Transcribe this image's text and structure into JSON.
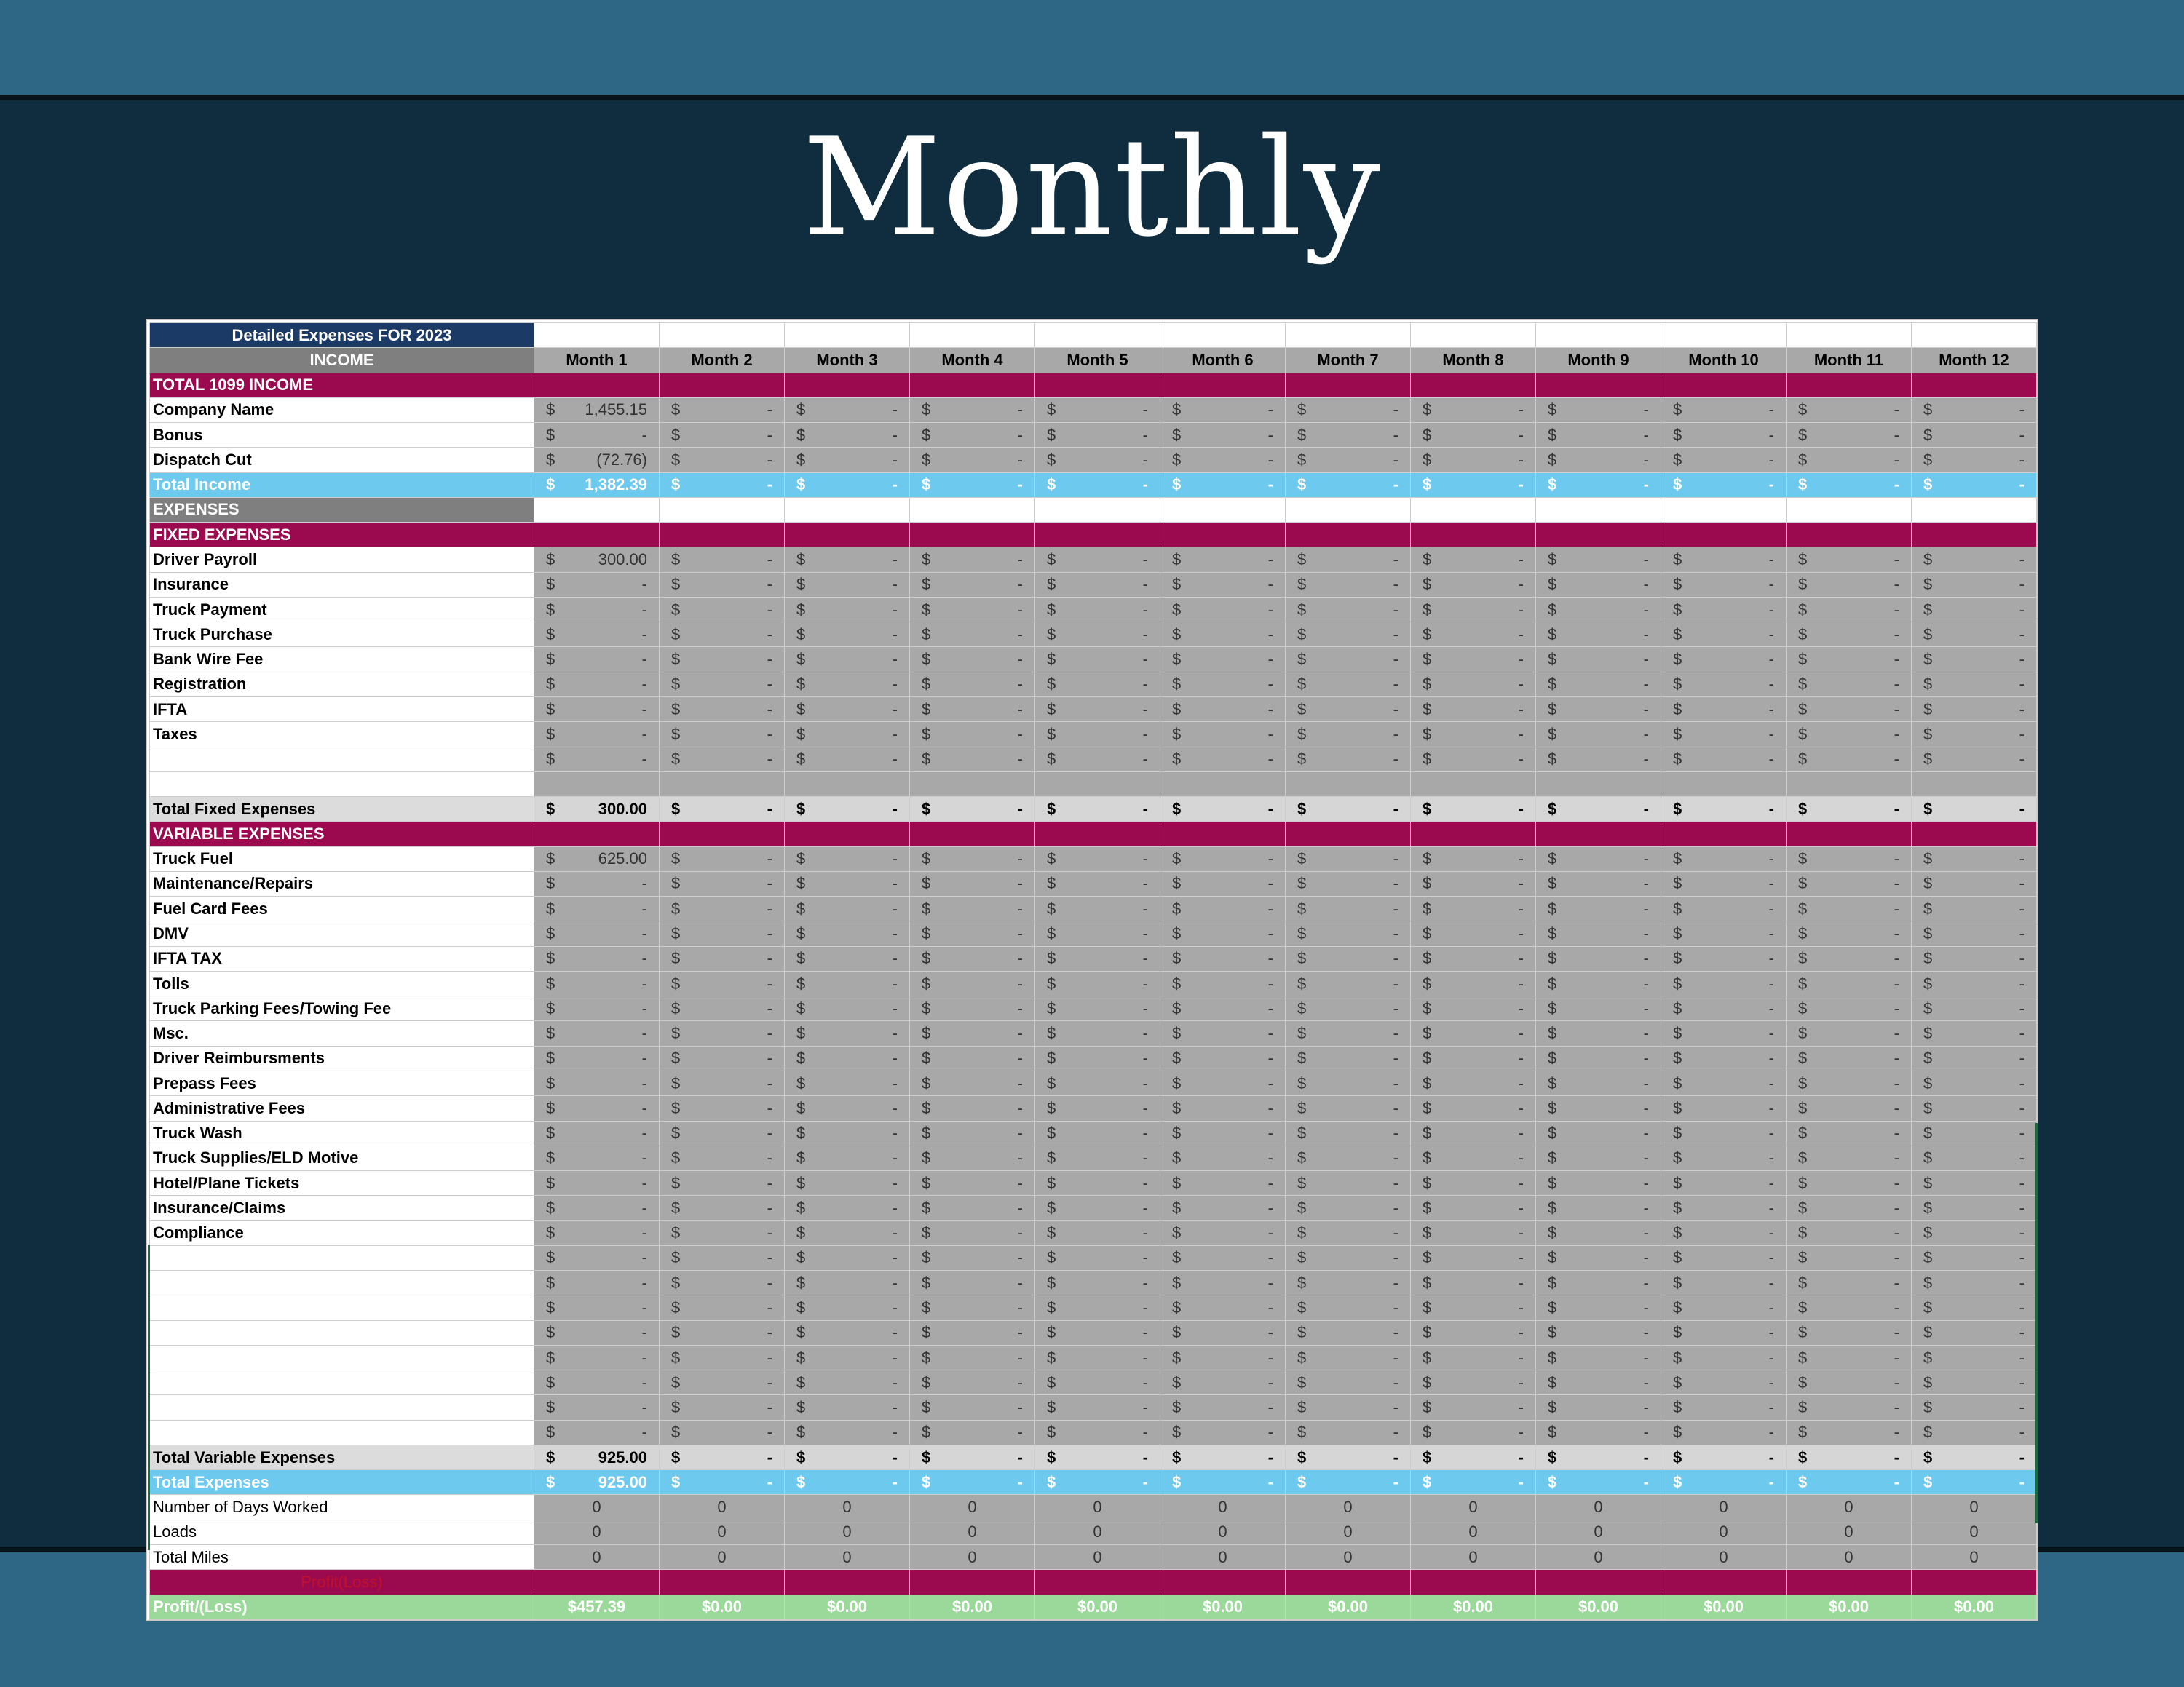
{
  "page_title": "Monthly",
  "sheet": {
    "title": "Detailed Expenses FOR 2023",
    "months": [
      "Month 1",
      "Month 2",
      "Month 3",
      "Month 4",
      "Month 5",
      "Month 6",
      "Month 7",
      "Month 8",
      "Month 9",
      "Month 10",
      "Month 11",
      "Month 12"
    ],
    "currency_symbol": "$",
    "dash": "-",
    "income_label": "INCOME",
    "total_1099_label": "TOTAL 1099 INCOME",
    "income_rows": [
      {
        "label": "Company Name",
        "first": "1,455.15"
      },
      {
        "label": "Bonus",
        "first": "-"
      },
      {
        "label": "Dispatch Cut",
        "first": "(72.76)"
      }
    ],
    "total_income": {
      "label": "Total Income",
      "first": "1,382.39"
    },
    "expenses_label": "EXPENSES",
    "fixed_label": "FIXED EXPENSES",
    "fixed_rows": [
      {
        "label": "Driver Payroll",
        "first": "300.00"
      },
      {
        "label": "Insurance",
        "first": "-"
      },
      {
        "label": "Truck Payment",
        "first": "-"
      },
      {
        "label": "Truck Purchase",
        "first": "-"
      },
      {
        "label": "Bank Wire Fee",
        "first": "-"
      },
      {
        "label": "Registration",
        "first": "-"
      },
      {
        "label": "IFTA",
        "first": "-"
      },
      {
        "label": "Taxes",
        "first": "-"
      },
      {
        "label": "",
        "first": "-"
      }
    ],
    "total_fixed": {
      "label": "Total Fixed Expenses",
      "first": "300.00"
    },
    "variable_label": "VARIABLE EXPENSES",
    "variable_rows": [
      {
        "label": "Truck Fuel",
        "first": "625.00"
      },
      {
        "label": "Maintenance/Repairs",
        "first": "-"
      },
      {
        "label": "Fuel Card Fees",
        "first": "-"
      },
      {
        "label": "DMV",
        "first": "-"
      },
      {
        "label": "IFTA TAX",
        "first": "-"
      },
      {
        "label": "Tolls",
        "first": "-"
      },
      {
        "label": "Truck Parking Fees/Towing Fee",
        "first": "-"
      },
      {
        "label": "Msc.",
        "first": "-"
      },
      {
        "label": "Driver Reimbursments",
        "first": "-"
      },
      {
        "label": "Prepass Fees",
        "first": "-"
      },
      {
        "label": "Administrative Fees",
        "first": "-"
      },
      {
        "label": "Truck Wash",
        "first": "-"
      },
      {
        "label": "Truck Supplies/ELD Motive",
        "first": "-"
      },
      {
        "label": "Hotel/Plane Tickets",
        "first": "-"
      },
      {
        "label": "Insurance/Claims",
        "first": "-"
      },
      {
        "label": "Compliance",
        "first": "-"
      },
      {
        "label": "",
        "first": "-"
      },
      {
        "label": "",
        "first": "-"
      },
      {
        "label": "",
        "first": "-"
      },
      {
        "label": "",
        "first": "-"
      },
      {
        "label": "",
        "first": "-"
      },
      {
        "label": "",
        "first": "-"
      },
      {
        "label": "",
        "first": "-"
      },
      {
        "label": "",
        "first": "-"
      }
    ],
    "total_variable": {
      "label": "Total Variable Expenses",
      "first": "925.00"
    },
    "total_expenses": {
      "label": "Total Expenses",
      "first": "925.00"
    },
    "stats_rows": [
      {
        "label": "Number of Days Worked",
        "values": [
          "0",
          "0",
          "0",
          "0",
          "0",
          "0",
          "0",
          "0",
          "0",
          "0",
          "0",
          "0"
        ]
      },
      {
        "label": "Loads",
        "values": [
          "0",
          "0",
          "0",
          "0",
          "0",
          "0",
          "0",
          "0",
          "0",
          "0",
          "0",
          "0"
        ]
      },
      {
        "label": "Total Miles",
        "values": [
          "0",
          "0",
          "0",
          "0",
          "0",
          "0",
          "0",
          "0",
          "0",
          "0",
          "0",
          "0"
        ]
      }
    ],
    "profit_header_label": "Profit(Loss)",
    "profit": {
      "label": "Profit/(Loss)",
      "values": [
        "$457.39",
        "$0.00",
        "$0.00",
        "$0.00",
        "$0.00",
        "$0.00",
        "$0.00",
        "$0.00",
        "$0.00",
        "$0.00",
        "$0.00",
        "$0.00"
      ]
    }
  },
  "colors": {
    "page_bg": "#2e6686",
    "band": "#0f2d3e",
    "title_cell": "#1c3a66",
    "section_gray": "#7f7f7f",
    "magenta": "#9b0a4e",
    "total_blue": "#6ec9ef",
    "profit_green": "#9ad99a",
    "cell_gray": "#a8a8a8"
  }
}
